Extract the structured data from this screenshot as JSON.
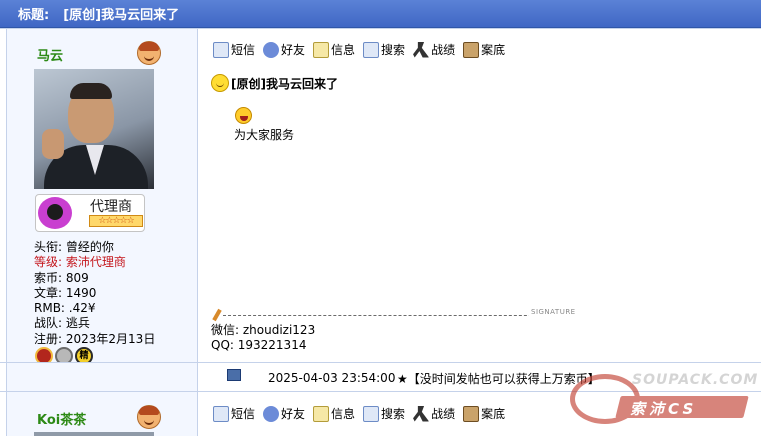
{
  "thread": {
    "title_label": "标题:",
    "title": "[原创]我马云回来了"
  },
  "toolbar": {
    "items": [
      {
        "label": "短信",
        "icon": "message-icon"
      },
      {
        "label": "好友",
        "icon": "friends-icon"
      },
      {
        "label": "信息",
        "icon": "info-icon"
      },
      {
        "label": "搜索",
        "icon": "search-icon"
      },
      {
        "label": "战绩",
        "icon": "record-icon"
      },
      {
        "label": "案底",
        "icon": "case-record-icon"
      }
    ]
  },
  "post1": {
    "author": "马云",
    "rank_title": "代理商",
    "rank_stars": "☆☆☆☆☆",
    "stats": {
      "title_label": "头衔:",
      "title_value": "曾经的你",
      "level_label": "等级:",
      "level_value": "索沛代理商",
      "coins_label": "索币:",
      "coins_value": "809",
      "posts_label": "文章:",
      "posts_value": "1490",
      "rmb_label": "RMB:",
      "rmb_value": ".42¥",
      "team_label": "战队:",
      "team_value": "逃兵",
      "reg_label": "注册:",
      "reg_value": "2023年2月13日"
    },
    "medal_text": "精",
    "content_title": "[原创]我马云回来了",
    "content_body": "为大家服务",
    "signature_label": "SIGNATURE",
    "signature_lines": [
      "微信: zhoudizi123",
      "QQ:  193221314"
    ],
    "footer_time": "2025-04-03 23:54:00",
    "footer_ad": "★【没时间发帖也可以获得上万索币】"
  },
  "post2": {
    "author": "Koi茶茶"
  },
  "watermark": {
    "text_top": "SOUPACK.COM",
    "text_cn": "索沛CS"
  },
  "colors": {
    "title_bar": "#4a72cf",
    "username": "#2d8a16",
    "level": "#c4161c",
    "side_bg": "#f3f7ff"
  }
}
